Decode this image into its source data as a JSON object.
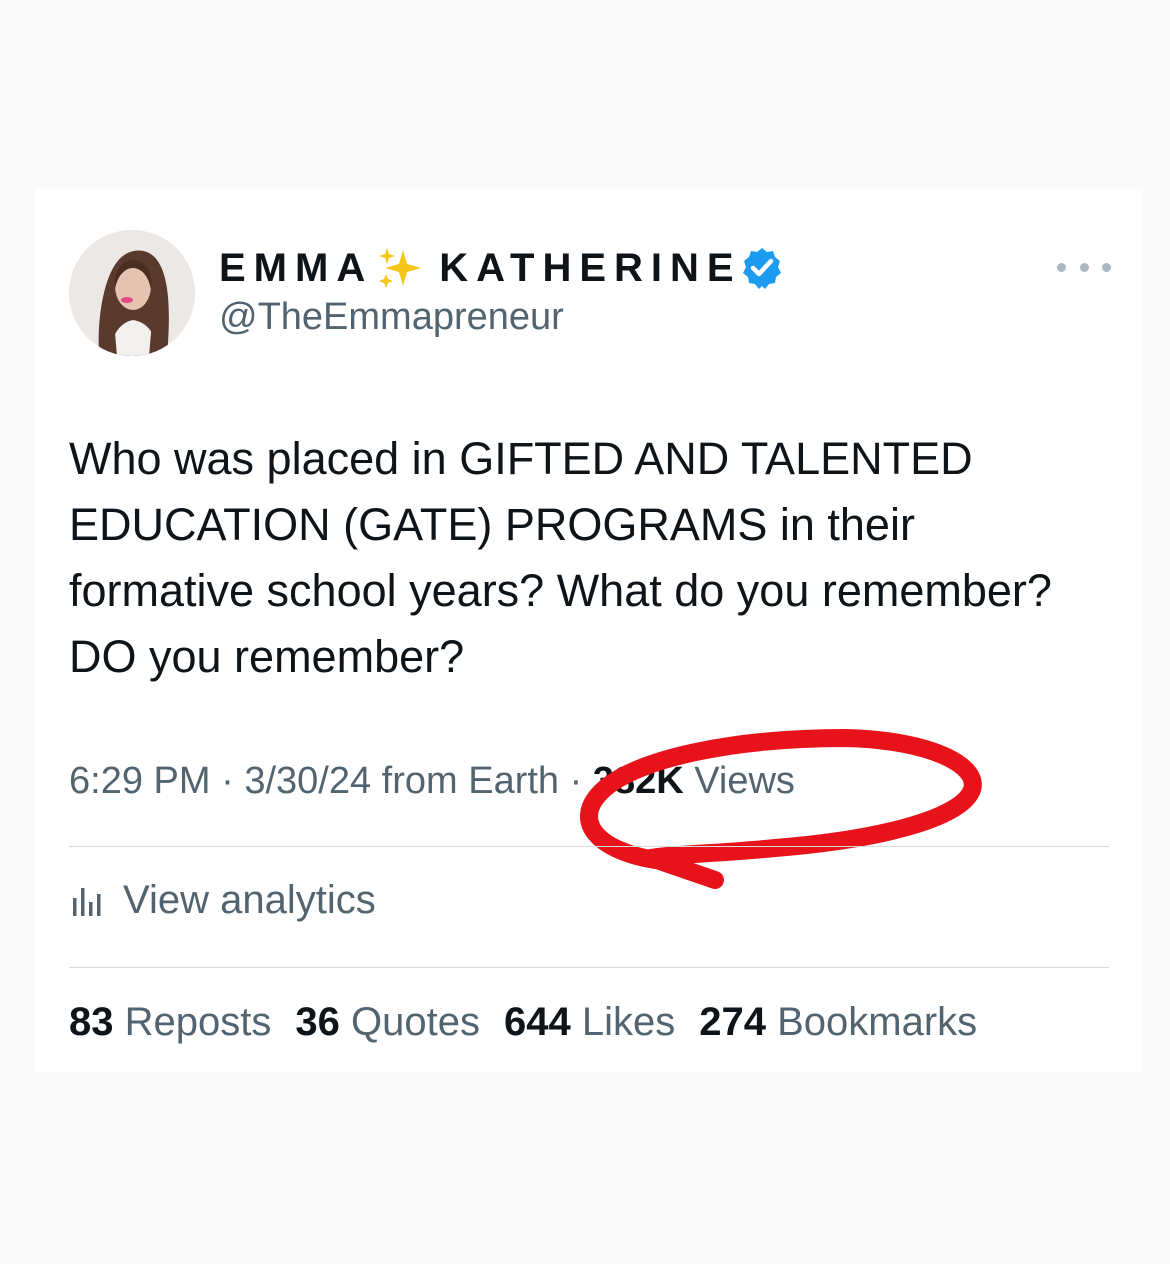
{
  "author": {
    "name_first": "EMMA",
    "name_last": "KATHERINE",
    "handle": "@TheEmmapreneur",
    "sparkle_icon": "sparkles-emoji",
    "verified_icon": "verified-badge-icon"
  },
  "tweet": {
    "text": "Who was placed in GIFTED AND TALENTED EDUCATION (GATE) PROGRAMS in their formative school years? What do you remember? DO you remember?"
  },
  "meta": {
    "time": "6:29 PM",
    "separator": "·",
    "date": "3/30/24",
    "source": "from Earth",
    "views_count": "382K",
    "views_label": "Views"
  },
  "analytics": {
    "label": "View analytics"
  },
  "stats": [
    {
      "count": "83",
      "label": "Reposts"
    },
    {
      "count": "36",
      "label": "Quotes"
    },
    {
      "count": "644",
      "label": "Likes"
    },
    {
      "count": "274",
      "label": "Bookmarks"
    }
  ],
  "colors": {
    "text_primary": "#0f1419",
    "text_secondary": "#536471",
    "verified_blue": "#1d9bf0",
    "annotation_red": "#e8121a",
    "divider": "#d5dadd"
  }
}
